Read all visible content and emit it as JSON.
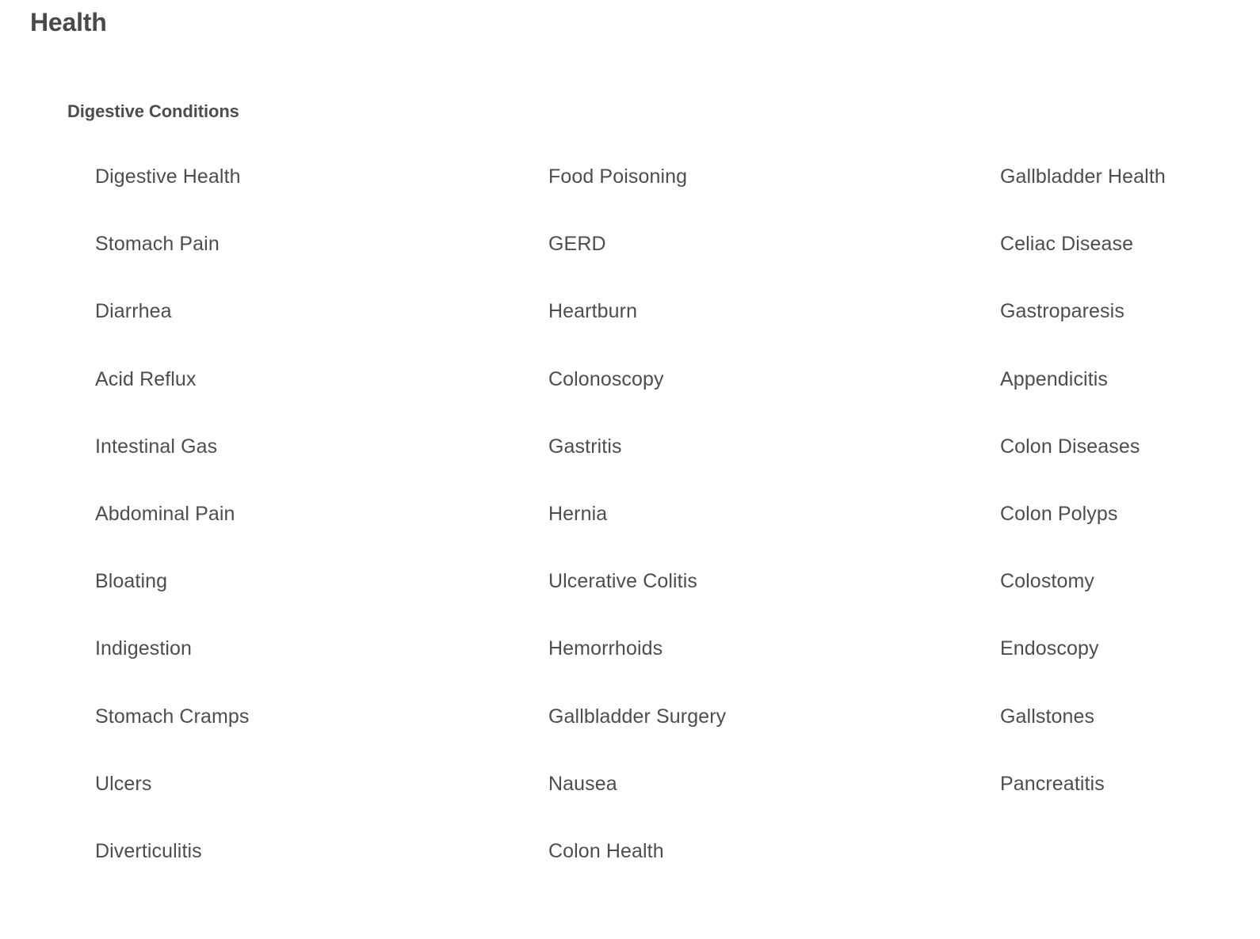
{
  "page": {
    "title": "Health",
    "background_color": "#ffffff",
    "title_color": "#494949",
    "heading_color": "#4d4d4d",
    "link_color": "#4d4d4d"
  },
  "section": {
    "heading": "Digestive Conditions",
    "columns": [
      {
        "items": [
          "Digestive Health",
          "Stomach Pain",
          "Diarrhea",
          "Acid Reflux",
          "Intestinal Gas",
          "Abdominal Pain",
          "Bloating",
          "Indigestion",
          "Stomach Cramps",
          "Ulcers",
          "Diverticulitis"
        ]
      },
      {
        "items": [
          "Food Poisoning",
          "GERD",
          "Heartburn",
          "Colonoscopy",
          "Gastritis",
          "Hernia",
          "Ulcerative Colitis",
          "Hemorrhoids",
          "Gallbladder Surgery",
          "Nausea",
          "Colon Health"
        ]
      },
      {
        "items": [
          "Gallbladder Health",
          "Celiac Disease",
          "Gastroparesis",
          "Appendicitis",
          "Colon Diseases",
          "Colon Polyps",
          "Colostomy",
          "Endoscopy",
          "Gallstones",
          "Pancreatitis"
        ]
      }
    ]
  }
}
